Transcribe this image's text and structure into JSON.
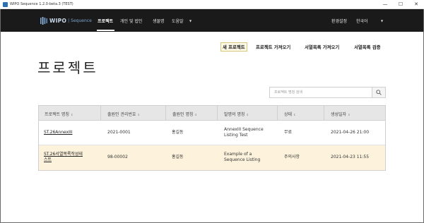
{
  "window": {
    "title": "WIPO Sequence 1.2.0-beta.3 (TEST)",
    "minimize": "—",
    "maximize": "☐",
    "close": "✕"
  },
  "nav": {
    "logo_wipo": "WIPO",
    "logo_separator": "|",
    "logo_product": "Sequence",
    "items": [
      "프로젝트",
      "개인 및 법인",
      "생물명",
      "도움말"
    ],
    "active": "프로젝트",
    "settings": "환경설정",
    "language": "한국어"
  },
  "actions": {
    "new_project": "새 프로젝트",
    "import_project": "프로젝트 가져오기",
    "import_listing": "서열목록 가져오기",
    "verify_listing": "서열목록 검증"
  },
  "page": {
    "title": "프로젝트"
  },
  "search": {
    "placeholder": "프로젝트 명칭 검색",
    "value": ""
  },
  "table": {
    "columns": [
      "프로젝트 명칭",
      "출원인 관리번호",
      "출원인 명칭",
      "발명의 명칭",
      "상태",
      "생성일자"
    ],
    "rows": [
      {
        "name_line1": "ST.26AnnexIII",
        "name_line2": "",
        "applicant_ref": "2021-0001",
        "applicant_name": "홍길동",
        "title_line1": "AnnexIII Sequence",
        "title_line2": "Listing Test",
        "status": "무료",
        "created": "2021-04-26 21:00"
      },
      {
        "name_line1": "ST.26서열목록작성테",
        "name_line2": "스트",
        "applicant_ref": "98-00002",
        "applicant_name": "홍길동",
        "title_line1": "Example of a",
        "title_line2": "Sequence Listing",
        "status": "주의사항",
        "created": "2021-04-23 11:55"
      }
    ],
    "sort_glyph": "⇕"
  },
  "colors": {
    "navbar": "#1a1a1a",
    "selected_row": "#fdf3dc",
    "header_bg": "#e6e6e6",
    "logo_accent": "#7aa6d4"
  },
  "icons": {
    "search": "search-icon",
    "caret": "caret-down-icon",
    "app": "app-icon"
  }
}
